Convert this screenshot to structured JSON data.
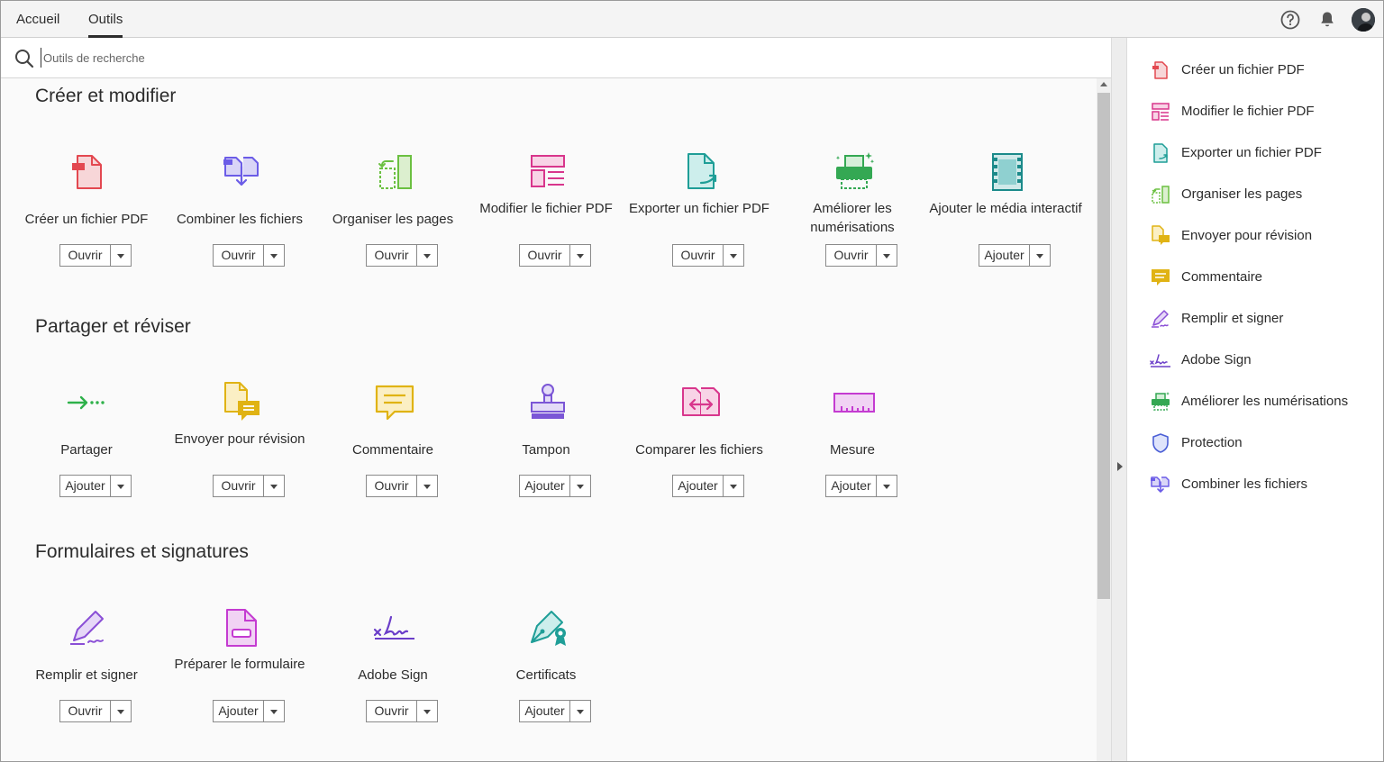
{
  "tabs": {
    "home": "Accueil",
    "tools": "Outils"
  },
  "search": {
    "placeholder": "Outils de recherche",
    "value": ""
  },
  "icons": {
    "help": "help-circle-icon",
    "notifications": "bell-icon",
    "account": "avatar"
  },
  "sections": {
    "create": {
      "title": "Créer et modifier",
      "tools": [
        {
          "label": "Créer un fichier PDF",
          "button": "Ouvrir",
          "color": "#e34850"
        },
        {
          "label": "Combiner les fichiers",
          "button": "Ouvrir",
          "color": "#6b5ce7"
        },
        {
          "label": "Organiser les pages",
          "button": "Ouvrir",
          "color": "#6bc041"
        },
        {
          "label": "Modifier le fichier PDF",
          "button": "Ouvrir",
          "color": "#d8368c"
        },
        {
          "label": "Exporter un fichier PDF",
          "button": "Ouvrir",
          "color": "#1f9e97"
        },
        {
          "label": "Améliorer les numérisations",
          "button": "Ouvrir",
          "color": "#34a853"
        },
        {
          "label": "Ajouter le média interactif",
          "button": "Ajouter",
          "color": "#1b8a8a"
        }
      ]
    },
    "share": {
      "title": "Partager et réviser",
      "tools": [
        {
          "label": "Partager",
          "button": "Ajouter",
          "color": "#2eb14a"
        },
        {
          "label": "Envoyer pour révision",
          "button": "Ouvrir",
          "color": "#e0b314"
        },
        {
          "label": "Commentaire",
          "button": "Ouvrir",
          "color": "#e0b314"
        },
        {
          "label": "Tampon",
          "button": "Ajouter",
          "color": "#7b56d6"
        },
        {
          "label": "Comparer les fichiers",
          "button": "Ajouter",
          "color": "#d8368c"
        },
        {
          "label": "Mesure",
          "button": "Ajouter",
          "color": "#c43bd1"
        }
      ]
    },
    "forms": {
      "title": "Formulaires et signatures",
      "tools": [
        {
          "label": "Remplir et signer",
          "button": "Ouvrir",
          "color": "#8a4fd6"
        },
        {
          "label": "Préparer le formulaire",
          "button": "Ajouter",
          "color": "#c43bd1"
        },
        {
          "label": "Adobe Sign",
          "button": "Ouvrir",
          "color": "#6b3ec9"
        },
        {
          "label": "Certificats",
          "button": "Ajouter",
          "color": "#1f9e97"
        }
      ]
    }
  },
  "rightpanel": [
    {
      "label": "Créer un fichier PDF",
      "icon": "create-pdf-icon"
    },
    {
      "label": "Modifier le fichier PDF",
      "icon": "edit-pdf-icon"
    },
    {
      "label": "Exporter un fichier PDF",
      "icon": "export-pdf-icon"
    },
    {
      "label": "Organiser les pages",
      "icon": "organize-pages-icon"
    },
    {
      "label": "Envoyer pour révision",
      "icon": "send-review-icon"
    },
    {
      "label": "Commentaire",
      "icon": "comment-icon"
    },
    {
      "label": "Remplir et signer",
      "icon": "fill-sign-icon"
    },
    {
      "label": "Adobe Sign",
      "icon": "adobe-sign-icon"
    },
    {
      "label": "Améliorer les numérisations",
      "icon": "enhance-scan-icon"
    },
    {
      "label": "Protection",
      "icon": "shield-icon"
    },
    {
      "label": "Combiner les fichiers",
      "icon": "combine-files-icon"
    }
  ]
}
